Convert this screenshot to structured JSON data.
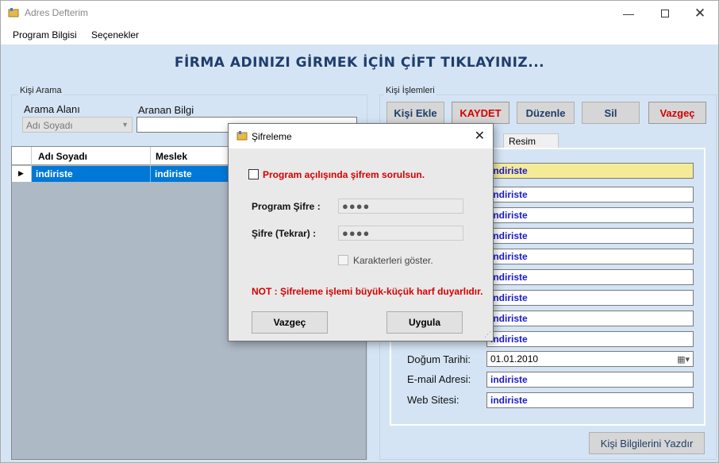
{
  "window": {
    "title": "Adres Defterim"
  },
  "menu": {
    "items": [
      "Program Bilgisi",
      "Seçenekler"
    ]
  },
  "banner": "FİRMA ADINIZI GİRMEK İÇİN ÇİFT TIKLAYINIZ...",
  "search": {
    "group_label": "Kişi Arama",
    "area_label": "Arama Alanı",
    "area_value": "Adı Soyadı",
    "info_label": "Aranan Bilgi",
    "info_value": ""
  },
  "grid": {
    "columns": [
      "Adı Soyadı",
      "Meslek"
    ],
    "rows": [
      {
        "indicator": "▶",
        "cells": [
          "indiriste",
          "indiriste"
        ]
      }
    ]
  },
  "actions": {
    "group_label": "Kişi İşlemleri",
    "buttons": [
      "Kişi Ekle",
      "KAYDET",
      "Düzenle",
      "Sil",
      "Vazgeç"
    ]
  },
  "tabs": {
    "resim": "Resim"
  },
  "form": {
    "fields": [
      {
        "value": "indiriste"
      },
      {
        "value": "indiriste"
      },
      {
        "value": "indiriste"
      },
      {
        "value": "indiriste"
      },
      {
        "value": "indiriste"
      },
      {
        "value": "indiriste"
      },
      {
        "value": "indiriste"
      },
      {
        "value": "indiriste"
      },
      {
        "value": "indiriste"
      },
      {
        "label": "Doğum Tarihi:",
        "value": "01.01.2010"
      },
      {
        "label": "E-mail Adresi:",
        "value": "indiriste"
      },
      {
        "label": "Web Sitesi:",
        "value": "indiriste"
      }
    ],
    "print_button": "Kişi Bilgilerini Yazdır"
  },
  "dialog": {
    "title": "Şifreleme",
    "ask_checkbox": "Program açılışında şifrem sorulsun.",
    "password_label": "Program Şifre :",
    "password_value": "●●●●",
    "repeat_label": "Şifre (Tekrar) :",
    "repeat_value": "●●●●",
    "show_chars": "Karakterleri göster.",
    "note": "NOT : Şifreleme işlemi büyük-küçük harf duyarlıdır.",
    "cancel": "Vazgeç",
    "apply": "Uygula"
  },
  "colors": {
    "banner": "#1f3d6b",
    "accent_red": "#d40000",
    "selection": "#0078d7",
    "highlight_field": "#f5ea98"
  }
}
